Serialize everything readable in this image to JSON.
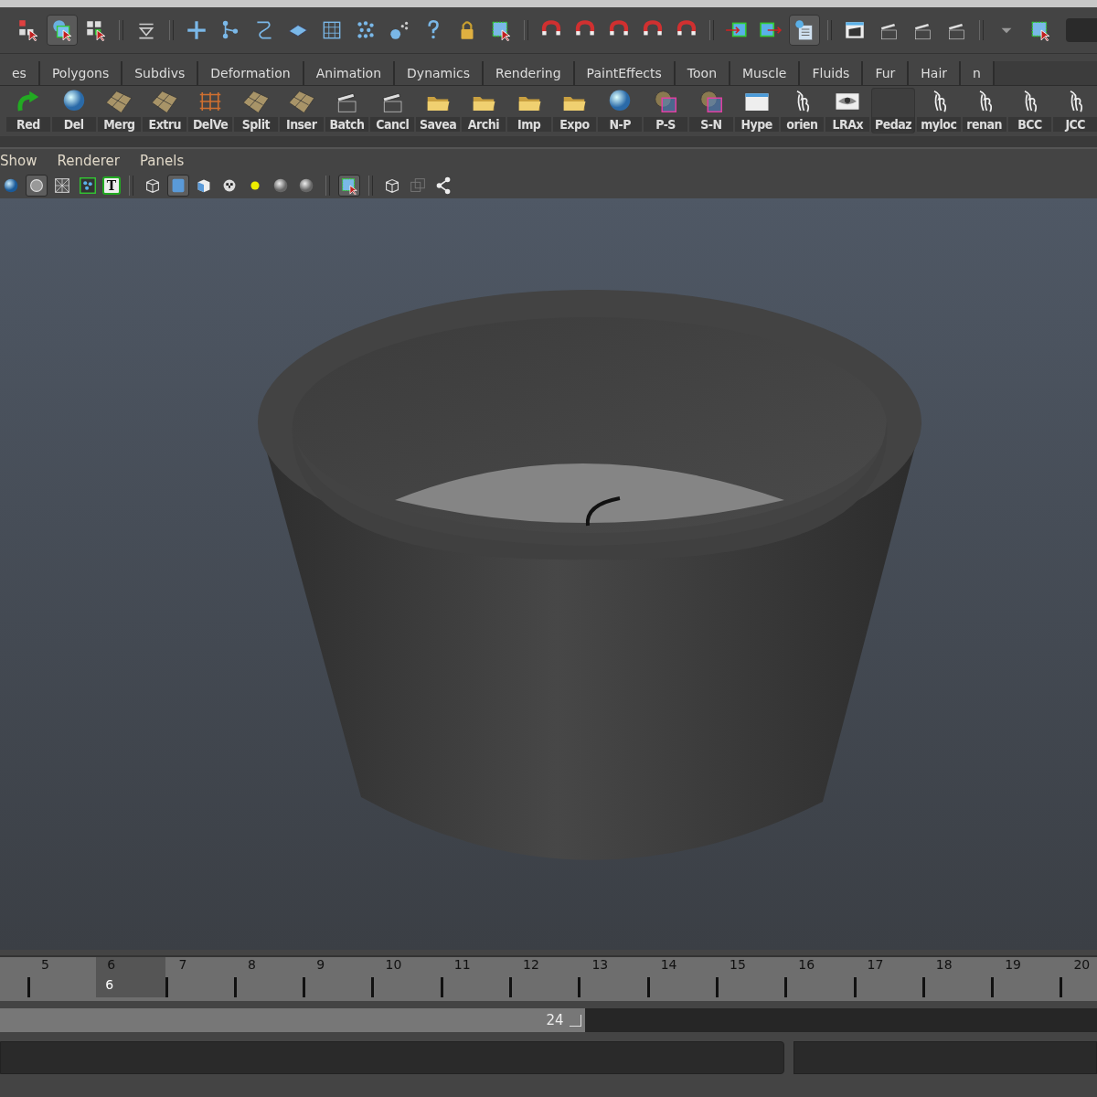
{
  "status_line": [
    {
      "kind": "select-hierarchy",
      "selected": false
    },
    {
      "kind": "select-object",
      "selected": true
    },
    {
      "kind": "select-component",
      "selected": false
    },
    {
      "kind": "sep"
    },
    {
      "kind": "layers",
      "selected": false
    },
    {
      "kind": "sep"
    },
    {
      "kind": "plus",
      "selected": false
    },
    {
      "kind": "nodes",
      "selected": false
    },
    {
      "kind": "curve",
      "selected": false
    },
    {
      "kind": "plane",
      "selected": false
    },
    {
      "kind": "lattice",
      "selected": false
    },
    {
      "kind": "particles",
      "selected": false
    },
    {
      "kind": "emitter",
      "selected": false
    },
    {
      "kind": "help",
      "selected": false
    },
    {
      "kind": "lock",
      "selected": false
    },
    {
      "kind": "select-box",
      "selected": false
    },
    {
      "kind": "sep"
    },
    {
      "kind": "magnet",
      "selected": false
    },
    {
      "kind": "magnet",
      "selected": false
    },
    {
      "kind": "magnet",
      "selected": false
    },
    {
      "kind": "magnet",
      "selected": false
    },
    {
      "kind": "magnet",
      "selected": false
    },
    {
      "kind": "sep"
    },
    {
      "kind": "input",
      "selected": false
    },
    {
      "kind": "output",
      "selected": false
    },
    {
      "kind": "history",
      "selected": true
    },
    {
      "kind": "sep"
    },
    {
      "kind": "render-window",
      "selected": false
    },
    {
      "kind": "clapper",
      "selected": false
    },
    {
      "kind": "clapper",
      "selected": false
    },
    {
      "kind": "clapper",
      "selected": false
    },
    {
      "kind": "sep"
    },
    {
      "kind": "triangle",
      "selected": false
    },
    {
      "kind": "select-box",
      "selected": false
    }
  ],
  "shelf_tabs": [
    {
      "label": "es",
      "selected": false
    },
    {
      "label": "Polygons",
      "selected": false
    },
    {
      "label": "Subdivs",
      "selected": false
    },
    {
      "label": "Deformation",
      "selected": false
    },
    {
      "label": "Animation",
      "selected": false
    },
    {
      "label": "Dynamics",
      "selected": false
    },
    {
      "label": "Rendering",
      "selected": false
    },
    {
      "label": "PaintEffects",
      "selected": false
    },
    {
      "label": "Toon",
      "selected": false
    },
    {
      "label": "Muscle",
      "selected": false
    },
    {
      "label": "Fluids",
      "selected": false
    },
    {
      "label": "Fur",
      "selected": false
    },
    {
      "label": "Hair",
      "selected": false
    },
    {
      "label": "n",
      "selected": false
    }
  ],
  "shelf_buttons": [
    {
      "label": "Red",
      "kind": "redo"
    },
    {
      "label": "Del",
      "kind": "sphere"
    },
    {
      "label": "Merg",
      "kind": "mesh"
    },
    {
      "label": "Extru",
      "kind": "mesh"
    },
    {
      "label": "DelVe",
      "kind": "grid"
    },
    {
      "label": "Split",
      "kind": "mesh"
    },
    {
      "label": "Inser",
      "kind": "mesh"
    },
    {
      "label": "Batch",
      "kind": "clapper"
    },
    {
      "label": "Cancl",
      "kind": "clapper"
    },
    {
      "label": "Savea",
      "kind": "folder"
    },
    {
      "label": "Archi",
      "kind": "folder"
    },
    {
      "label": "Imp",
      "kind": "folder"
    },
    {
      "label": "Expo",
      "kind": "folder"
    },
    {
      "label": "N-P",
      "kind": "sphere"
    },
    {
      "label": "P-S",
      "kind": "globe"
    },
    {
      "label": "S-N",
      "kind": "globe"
    },
    {
      "label": "Hype",
      "kind": "window"
    },
    {
      "label": "orien",
      "kind": "script"
    },
    {
      "label": "LRAx",
      "kind": "eye"
    },
    {
      "label": "Pedaz",
      "kind": "blank"
    },
    {
      "label": "myloc",
      "kind": "script"
    },
    {
      "label": "renan",
      "kind": "script"
    },
    {
      "label": "BCC",
      "kind": "script"
    },
    {
      "label": "JCC",
      "kind": "script"
    }
  ],
  "panel_menu": [
    "Show",
    "Renderer",
    "Panels"
  ],
  "panel_toolbar": [
    {
      "kind": "shaded-sphere",
      "selected": false
    },
    {
      "kind": "circle",
      "selected": true
    },
    {
      "kind": "wire-x",
      "selected": false
    },
    {
      "kind": "dots",
      "selected": false
    },
    {
      "kind": "text",
      "label": "T",
      "selected": false
    },
    {
      "kind": "sep"
    },
    {
      "kind": "wire-cube",
      "selected": false
    },
    {
      "kind": "solid-cube",
      "selected": true
    },
    {
      "kind": "cube",
      "selected": false
    },
    {
      "kind": "checker",
      "selected": false
    },
    {
      "kind": "light",
      "selected": false
    },
    {
      "kind": "grey-sphere",
      "selected": false
    },
    {
      "kind": "grey-sphere",
      "selected": false
    },
    {
      "kind": "sep"
    },
    {
      "kind": "select-box",
      "selected": true
    },
    {
      "kind": "sep"
    },
    {
      "kind": "wire-cube",
      "selected": false
    },
    {
      "kind": "squares",
      "selected": false
    },
    {
      "kind": "share",
      "selected": false
    }
  ],
  "time_slider": {
    "frames": [
      {
        "label": "5",
        "selected": false
      },
      {
        "label": "6",
        "selected": true
      },
      {
        "label": "7",
        "selected": false
      },
      {
        "label": "8",
        "selected": false
      },
      {
        "label": "9",
        "selected": false
      },
      {
        "label": "10",
        "selected": false
      },
      {
        "label": "11",
        "selected": false
      },
      {
        "label": "12",
        "selected": false
      },
      {
        "label": "13",
        "selected": false
      },
      {
        "label": "14",
        "selected": false
      },
      {
        "label": "15",
        "selected": false
      },
      {
        "label": "16",
        "selected": false
      },
      {
        "label": "17",
        "selected": false
      },
      {
        "label": "18",
        "selected": false
      },
      {
        "label": "19",
        "selected": false
      },
      {
        "label": "20",
        "selected": false
      }
    ],
    "current": "6"
  },
  "range_slider": {
    "end": "24",
    "level": 0.533
  }
}
